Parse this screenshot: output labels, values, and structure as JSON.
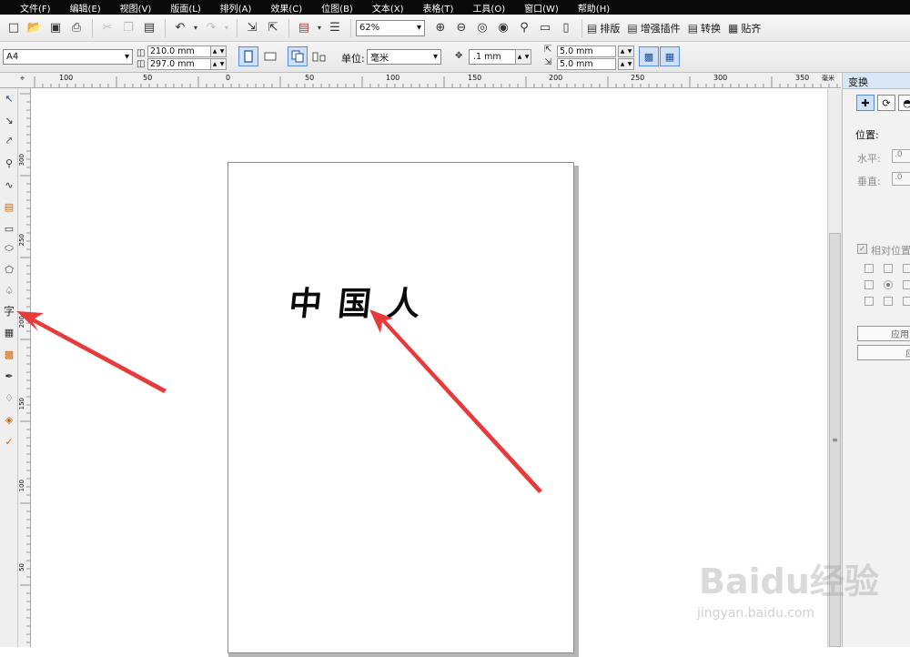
{
  "menu": [
    "文件(F)",
    "编辑(E)",
    "视图(V)",
    "版面(L)",
    "排列(A)",
    "效果(C)",
    "位图(B)",
    "文本(X)",
    "表格(T)",
    "工具(O)",
    "窗口(W)",
    "帮助(H)"
  ],
  "toolbar": {
    "zoom": "62%",
    "layout_label": "排版",
    "plugin_label": "增强插件",
    "convert_label": "转换",
    "snap_label": "贴齐"
  },
  "property_bar": {
    "paper": "A4",
    "width": "210.0 mm",
    "height": "297.0 mm",
    "unit_label": "单位:",
    "unit_value": "毫米",
    "nudge": ".1 mm",
    "dup_x": "5.0 mm",
    "dup_y": "5.0 mm"
  },
  "ruler": {
    "top_labels": [
      "100",
      "50",
      "0",
      "50",
      "100",
      "150",
      "200",
      "250",
      "300",
      "350"
    ],
    "top_unit": "毫米",
    "left_labels": [
      "300",
      "250",
      "200",
      "150",
      "100",
      "50"
    ]
  },
  "canvas": {
    "text": "中国人"
  },
  "panel": {
    "title": "变换",
    "position_label": "位置:",
    "horizontal_label": "水平:",
    "horizontal_value": ".0",
    "vertical_label": "垂直:",
    "vertical_value": ".0",
    "relative_label": "相对位置",
    "apply_copy_label": "应用到",
    "apply_label": "应"
  },
  "toolbox": {
    "text_tool_glyph": "字"
  },
  "watermark": {
    "logo": "Baidu经验",
    "url": "jingyan.baidu.com"
  },
  "colors": {
    "arrow": "#e83a3a",
    "menubar": "#0a0a0a",
    "panel_tab": "#d9e7f7"
  }
}
